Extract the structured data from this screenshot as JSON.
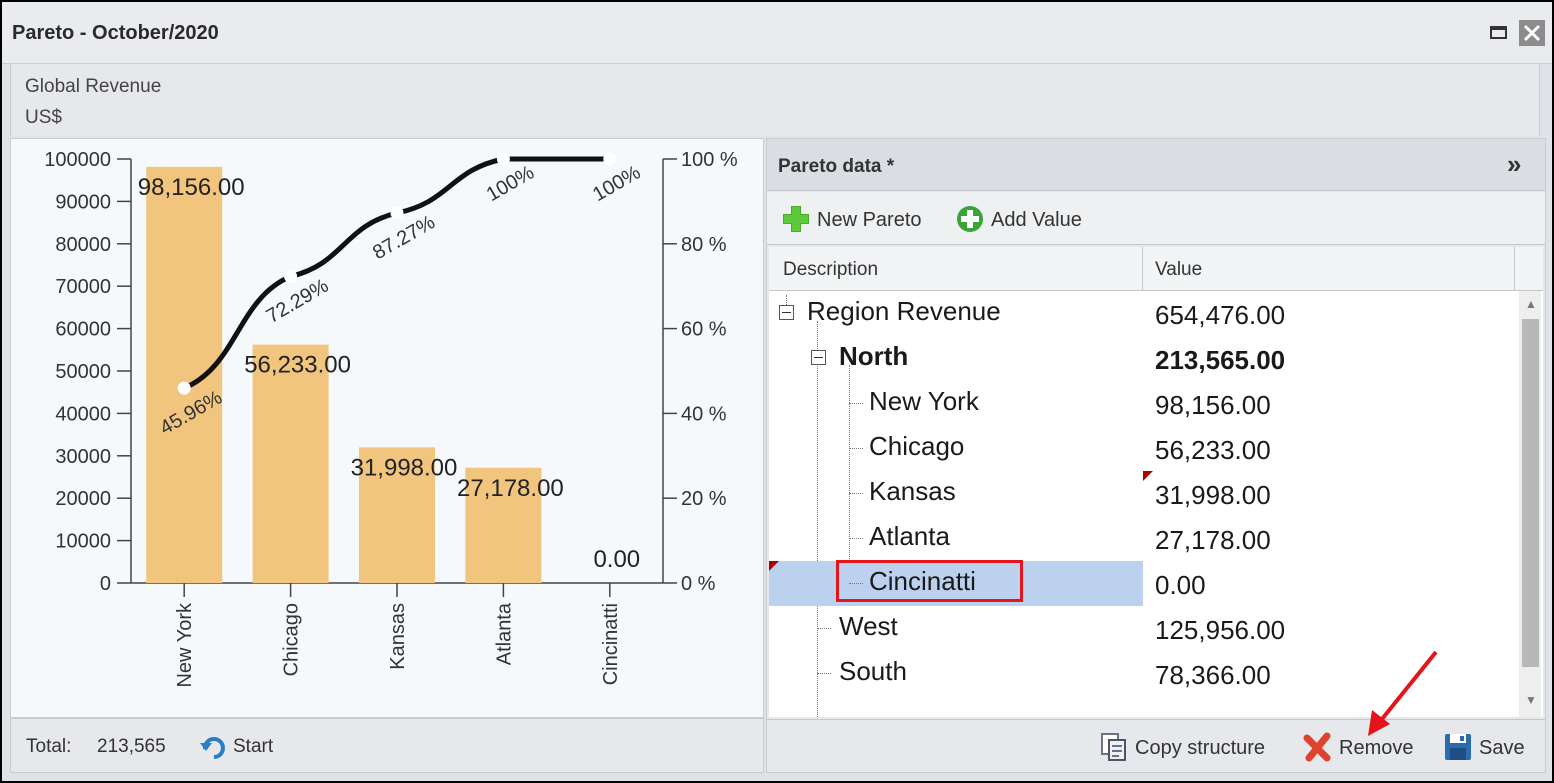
{
  "window": {
    "title": "Pareto - October/2020"
  },
  "header": {
    "line1": "Global Revenue",
    "line2": "US$"
  },
  "footer": {
    "total_label": "Total:",
    "total_value": "213,565",
    "start_label": "Start"
  },
  "data_panel": {
    "title": "Pareto data *",
    "toolbar": {
      "new_pareto": "New Pareto",
      "add_value": "Add Value"
    },
    "columns": {
      "description": "Description",
      "value": "Value"
    },
    "rows": [
      {
        "description": "Region Revenue",
        "value": "654,476.00"
      },
      {
        "description": "North",
        "value": "213,565.00"
      },
      {
        "description": "New York",
        "value": "98,156.00"
      },
      {
        "description": "Chicago",
        "value": "56,233.00"
      },
      {
        "description": "Kansas",
        "value": "31,998.00"
      },
      {
        "description": "Atlanta",
        "value": "27,178.00"
      },
      {
        "description": "Cincinatti",
        "value": "0.00"
      },
      {
        "description": "West",
        "value": "125,956.00"
      },
      {
        "description": "South",
        "value": "78,366.00"
      }
    ],
    "footer": {
      "copy_structure": "Copy structure",
      "remove": "Remove",
      "save": "Save"
    }
  },
  "colors": {
    "bar": "#f1c57e",
    "line": "#111111",
    "selection": "#bcd1ee",
    "highlight": "#e3151a"
  },
  "chart_data": {
    "type": "bar",
    "categories": [
      "New York",
      "Chicago",
      "Kansas",
      "Atlanta",
      "Cincinatti"
    ],
    "values": [
      98156,
      56233,
      31998,
      27178,
      0
    ],
    "value_labels": [
      "98,156.00",
      "56,233.00",
      "31,998.00",
      "27,178.00",
      "0.00"
    ],
    "cumulative_percent": [
      45.96,
      72.29,
      87.27,
      100,
      100
    ],
    "cumulative_labels": [
      "45.96%",
      "72.29%",
      "87.27%",
      "100%",
      "100%"
    ],
    "y_ticks": [
      "0",
      "10000",
      "20000",
      "30000",
      "40000",
      "50000",
      "60000",
      "70000",
      "80000",
      "90000",
      "100000"
    ],
    "y2_ticks": [
      "0 %",
      "20 %",
      "40 %",
      "60 %",
      "80 %",
      "100 %"
    ],
    "ylim": [
      0,
      100000
    ],
    "y2lim": [
      0,
      100
    ]
  }
}
